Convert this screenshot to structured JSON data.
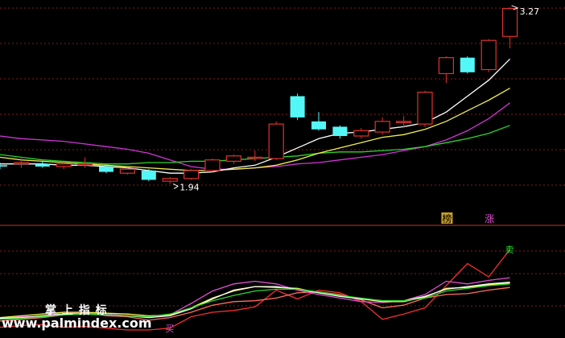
{
  "colors": {
    "background": "#000000",
    "grid": "#8b1a1a",
    "separator": "#c0392b",
    "up_candle": "#e0312c",
    "down_candle": "#54f7f7",
    "ma_fast": "#ffffff",
    "ma_mid": "#f2ef4c",
    "ma_long": "#2bd62b",
    "ma_longest": "#d234d8",
    "ind_red": "#f2302f",
    "ind_pink": "#e34fd6",
    "ind_yellow": "#f2ef4c",
    "ind_white": "#ffffff",
    "ind_green": "#2bd62b",
    "ind_salmon": "#ff6f5e",
    "watermark": "#ffffff",
    "label_badge_bg": "#c9a227"
  },
  "watermark": {
    "title": "掌 上 指 标",
    "url": "www.palmindex.com"
  },
  "chart_data": [
    {
      "type": "candlestick",
      "panel": "price",
      "price_high_label": "3.27",
      "price_low_label": "1.94",
      "badges": [
        {
          "text": "榜",
          "bar_index": 21
        },
        {
          "text": "涨",
          "bar_index": 23
        }
      ],
      "ylim": [
        1.7,
        3.3
      ],
      "candles": [
        {
          "open": 2.08,
          "close": 2.07,
          "high": 2.1,
          "low": 2.05
        },
        {
          "open": 2.1,
          "close": 2.1,
          "high": 2.14,
          "low": 2.06
        },
        {
          "open": 2.09,
          "close": 2.07,
          "high": 2.11,
          "low": 2.06
        },
        {
          "open": 2.07,
          "close": 2.09,
          "high": 2.1,
          "low": 2.05
        },
        {
          "open": 2.09,
          "close": 2.09,
          "high": 2.14,
          "low": 2.06
        },
        {
          "open": 2.07,
          "close": 2.03,
          "high": 2.08,
          "low": 2.02
        },
        {
          "open": 2.02,
          "close": 2.05,
          "high": 2.06,
          "low": 2.01
        },
        {
          "open": 2.04,
          "close": 1.97,
          "high": 2.05,
          "low": 1.96
        },
        {
          "open": 1.96,
          "close": 1.98,
          "high": 1.99,
          "low": 1.94
        },
        {
          "open": 1.98,
          "close": 2.04,
          "high": 2.05,
          "low": 1.97
        },
        {
          "open": 2.04,
          "close": 2.12,
          "high": 2.13,
          "low": 2.03
        },
        {
          "open": 2.11,
          "close": 2.15,
          "high": 2.16,
          "low": 2.09
        },
        {
          "open": 2.14,
          "close": 2.14,
          "high": 2.19,
          "low": 2.11
        },
        {
          "open": 2.13,
          "close": 2.39,
          "high": 2.41,
          "low": 2.12
        },
        {
          "open": 2.6,
          "close": 2.44,
          "high": 2.62,
          "low": 2.42
        },
        {
          "open": 2.41,
          "close": 2.35,
          "high": 2.48,
          "low": 2.34
        },
        {
          "open": 2.37,
          "close": 2.3,
          "high": 2.38,
          "low": 2.28
        },
        {
          "open": 2.3,
          "close": 2.34,
          "high": 2.36,
          "low": 2.28
        },
        {
          "open": 2.33,
          "close": 2.41,
          "high": 2.44,
          "low": 2.31
        },
        {
          "open": 2.41,
          "close": 2.41,
          "high": 2.45,
          "low": 2.36
        },
        {
          "open": 2.39,
          "close": 2.63,
          "high": 2.64,
          "low": 2.37
        },
        {
          "open": 2.77,
          "close": 2.89,
          "high": 2.9,
          "low": 2.7
        },
        {
          "open": 2.89,
          "close": 2.78,
          "high": 2.9,
          "low": 2.77
        },
        {
          "open": 2.8,
          "close": 3.02,
          "high": 3.03,
          "low": 2.78
        },
        {
          "open": 3.05,
          "close": 3.26,
          "high": 3.27,
          "low": 2.96
        }
      ],
      "ma_fast": [
        2.09,
        2.09,
        2.09,
        2.08,
        2.08,
        2.07,
        2.06,
        2.04,
        2.02,
        2.02,
        2.03,
        2.06,
        2.08,
        2.14,
        2.21,
        2.28,
        2.32,
        2.33,
        2.35,
        2.37,
        2.4,
        2.48,
        2.6,
        2.72,
        2.88
      ],
      "ma_mid": [
        2.14,
        2.12,
        2.11,
        2.1,
        2.09,
        2.08,
        2.07,
        2.06,
        2.05,
        2.04,
        2.04,
        2.05,
        2.06,
        2.08,
        2.12,
        2.17,
        2.21,
        2.25,
        2.29,
        2.31,
        2.35,
        2.41,
        2.49,
        2.57,
        2.66
      ],
      "ma_long": [
        2.16,
        2.14,
        2.12,
        2.11,
        2.1,
        2.09,
        2.09,
        2.1,
        2.1,
        2.11,
        2.11,
        2.12,
        2.13,
        2.14,
        2.15,
        2.17,
        2.18,
        2.18,
        2.19,
        2.2,
        2.22,
        2.25,
        2.28,
        2.32,
        2.38
      ],
      "ma_longest": [
        2.3,
        2.28,
        2.27,
        2.26,
        2.24,
        2.22,
        2.2,
        2.17,
        2.12,
        2.07,
        2.05,
        2.05,
        2.06,
        2.07,
        2.09,
        2.1,
        2.12,
        2.14,
        2.16,
        2.19,
        2.22,
        2.27,
        2.34,
        2.43,
        2.55
      ]
    },
    {
      "type": "line",
      "panel": "indicator",
      "signal_labels": [
        {
          "text": "买",
          "bar_index": 8
        },
        {
          "text": "卖",
          "bar_index": 24
        }
      ],
      "ylim": [
        0,
        100
      ],
      "series": [
        {
          "key": "ind_red",
          "values": [
            3,
            5,
            6,
            3,
            4,
            2,
            0,
            0,
            2,
            15,
            20,
            22,
            26,
            45,
            35,
            45,
            42,
            32,
            12,
            18,
            25,
            50,
            75,
            60,
            91
          ]
        },
        {
          "key": "ind_salmon",
          "values": [
            10,
            12,
            14,
            17,
            20,
            16,
            15,
            11,
            14,
            20,
            28,
            32,
            33,
            36,
            42,
            43,
            40,
            34,
            25,
            28,
            36,
            40,
            41,
            45,
            48
          ]
        },
        {
          "key": "ind_pink",
          "values": [
            14,
            15,
            15,
            20,
            19,
            18,
            16,
            14,
            17,
            30,
            44,
            52,
            55,
            52,
            45,
            40,
            36,
            32,
            31,
            33,
            40,
            55,
            52,
            56,
            59
          ]
        },
        {
          "key": "ind_yellow",
          "values": [
            14,
            16,
            18,
            20,
            20,
            19,
            18,
            16,
            17,
            25,
            36,
            44,
            49,
            48,
            47,
            42,
            38,
            35,
            32,
            32,
            37,
            47,
            48,
            51,
            53
          ]
        },
        {
          "key": "ind_white",
          "values": [
            13,
            14,
            16,
            18,
            18,
            17,
            16,
            14,
            16,
            24,
            35,
            45,
            49,
            49,
            46,
            42,
            38,
            35,
            33,
            33,
            38,
            46,
            49,
            52,
            54
          ]
        },
        {
          "key": "ind_green",
          "values": [
            12,
            13,
            15,
            17,
            18,
            17,
            16,
            15,
            18,
            25,
            33,
            39,
            44,
            46,
            46,
            43,
            39,
            36,
            33,
            33,
            36,
            44,
            47,
            50,
            52
          ]
        }
      ]
    }
  ]
}
